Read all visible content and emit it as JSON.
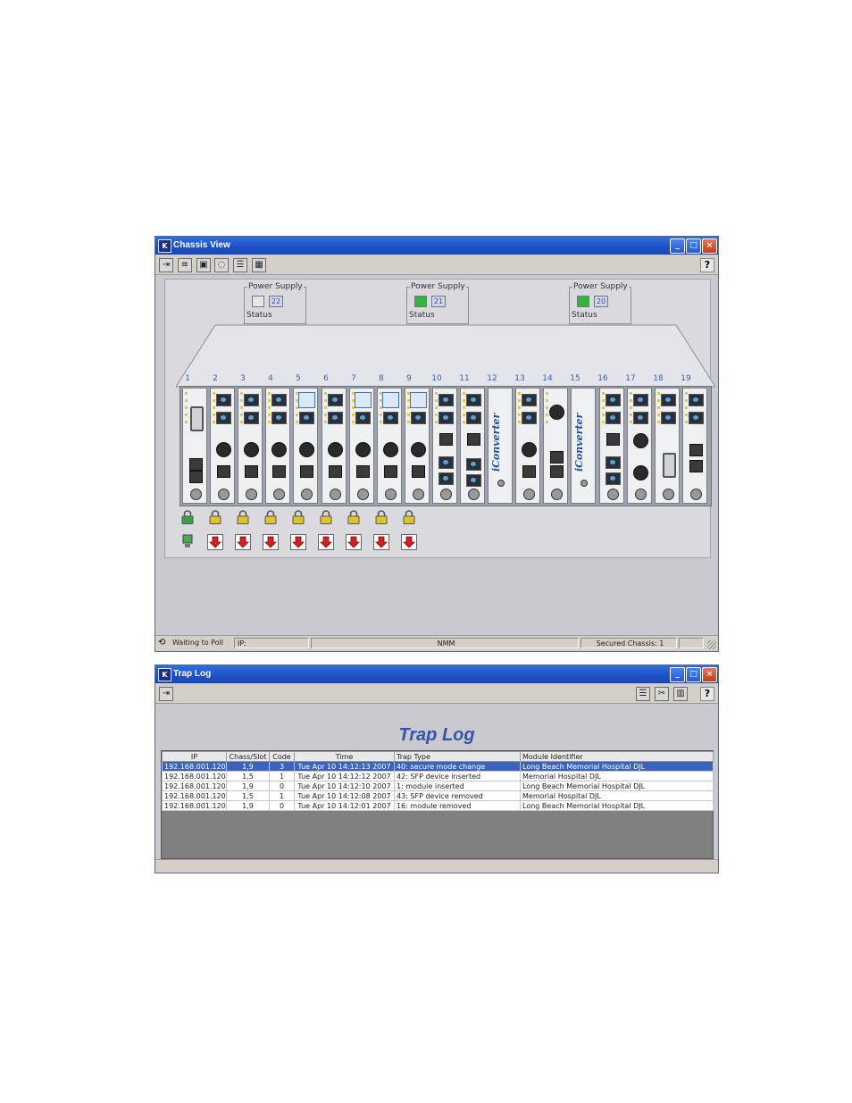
{
  "chassis_window": {
    "title": "Chassis View",
    "power_supplies": [
      {
        "label": "Power Supply",
        "status_label": "Status",
        "number": "22",
        "led_color": "#e6e6e6"
      },
      {
        "label": "Power Supply",
        "status_label": "Status",
        "number": "21",
        "led_color": "#33b53f"
      },
      {
        "label": "Power Supply",
        "status_label": "Status",
        "number": "20",
        "led_color": "#33b53f"
      }
    ],
    "slot_numbers": [
      "1",
      "2",
      "3",
      "4",
      "5",
      "6",
      "7",
      "8",
      "9",
      "10",
      "11",
      "12",
      "13",
      "14",
      "15",
      "16",
      "17",
      "18",
      "19"
    ],
    "iconverter_text": "iConverter",
    "status_bar": {
      "poll": "Waiting to Poll",
      "ip": "IP:",
      "mode": "NMM",
      "secured": "Secured Chassis: 1"
    }
  },
  "trap_window": {
    "title": "Trap Log",
    "heading": "Trap Log",
    "columns": [
      "IP",
      "Chass/Slot",
      "Code",
      "Time",
      "Trap Type",
      "Module Identifier"
    ],
    "rows": [
      [
        "192.168.001.120",
        "1,9",
        "3",
        "Tue Apr 10 14:12:13 2007",
        "40: secure mode change",
        "Long Beach Memorial Hospital DJL"
      ],
      [
        "192.168.001.120",
        "1,5",
        "1",
        "Tue Apr 10 14:12:12 2007",
        "42: SFP device inserted",
        "Memorial Hospital DJL"
      ],
      [
        "192.168.001.120",
        "1,9",
        "0",
        "Tue Apr 10 14:12:10 2007",
        "1: module inserted",
        "Long Beach Memorial Hospital DJL"
      ],
      [
        "192.168.001.120",
        "1,5",
        "1",
        "Tue Apr 10 14:12:08 2007",
        "43: SFP device removed",
        "Memorial Hospital DJL"
      ],
      [
        "192.168.001.120",
        "1,9",
        "0",
        "Tue Apr 10 14:12:01 2007",
        "16: module removed",
        "Long Beach Memorial Hospital DJL"
      ]
    ]
  },
  "common": {
    "minimize": "_",
    "maximize": "□",
    "close": "×",
    "help": "?"
  }
}
